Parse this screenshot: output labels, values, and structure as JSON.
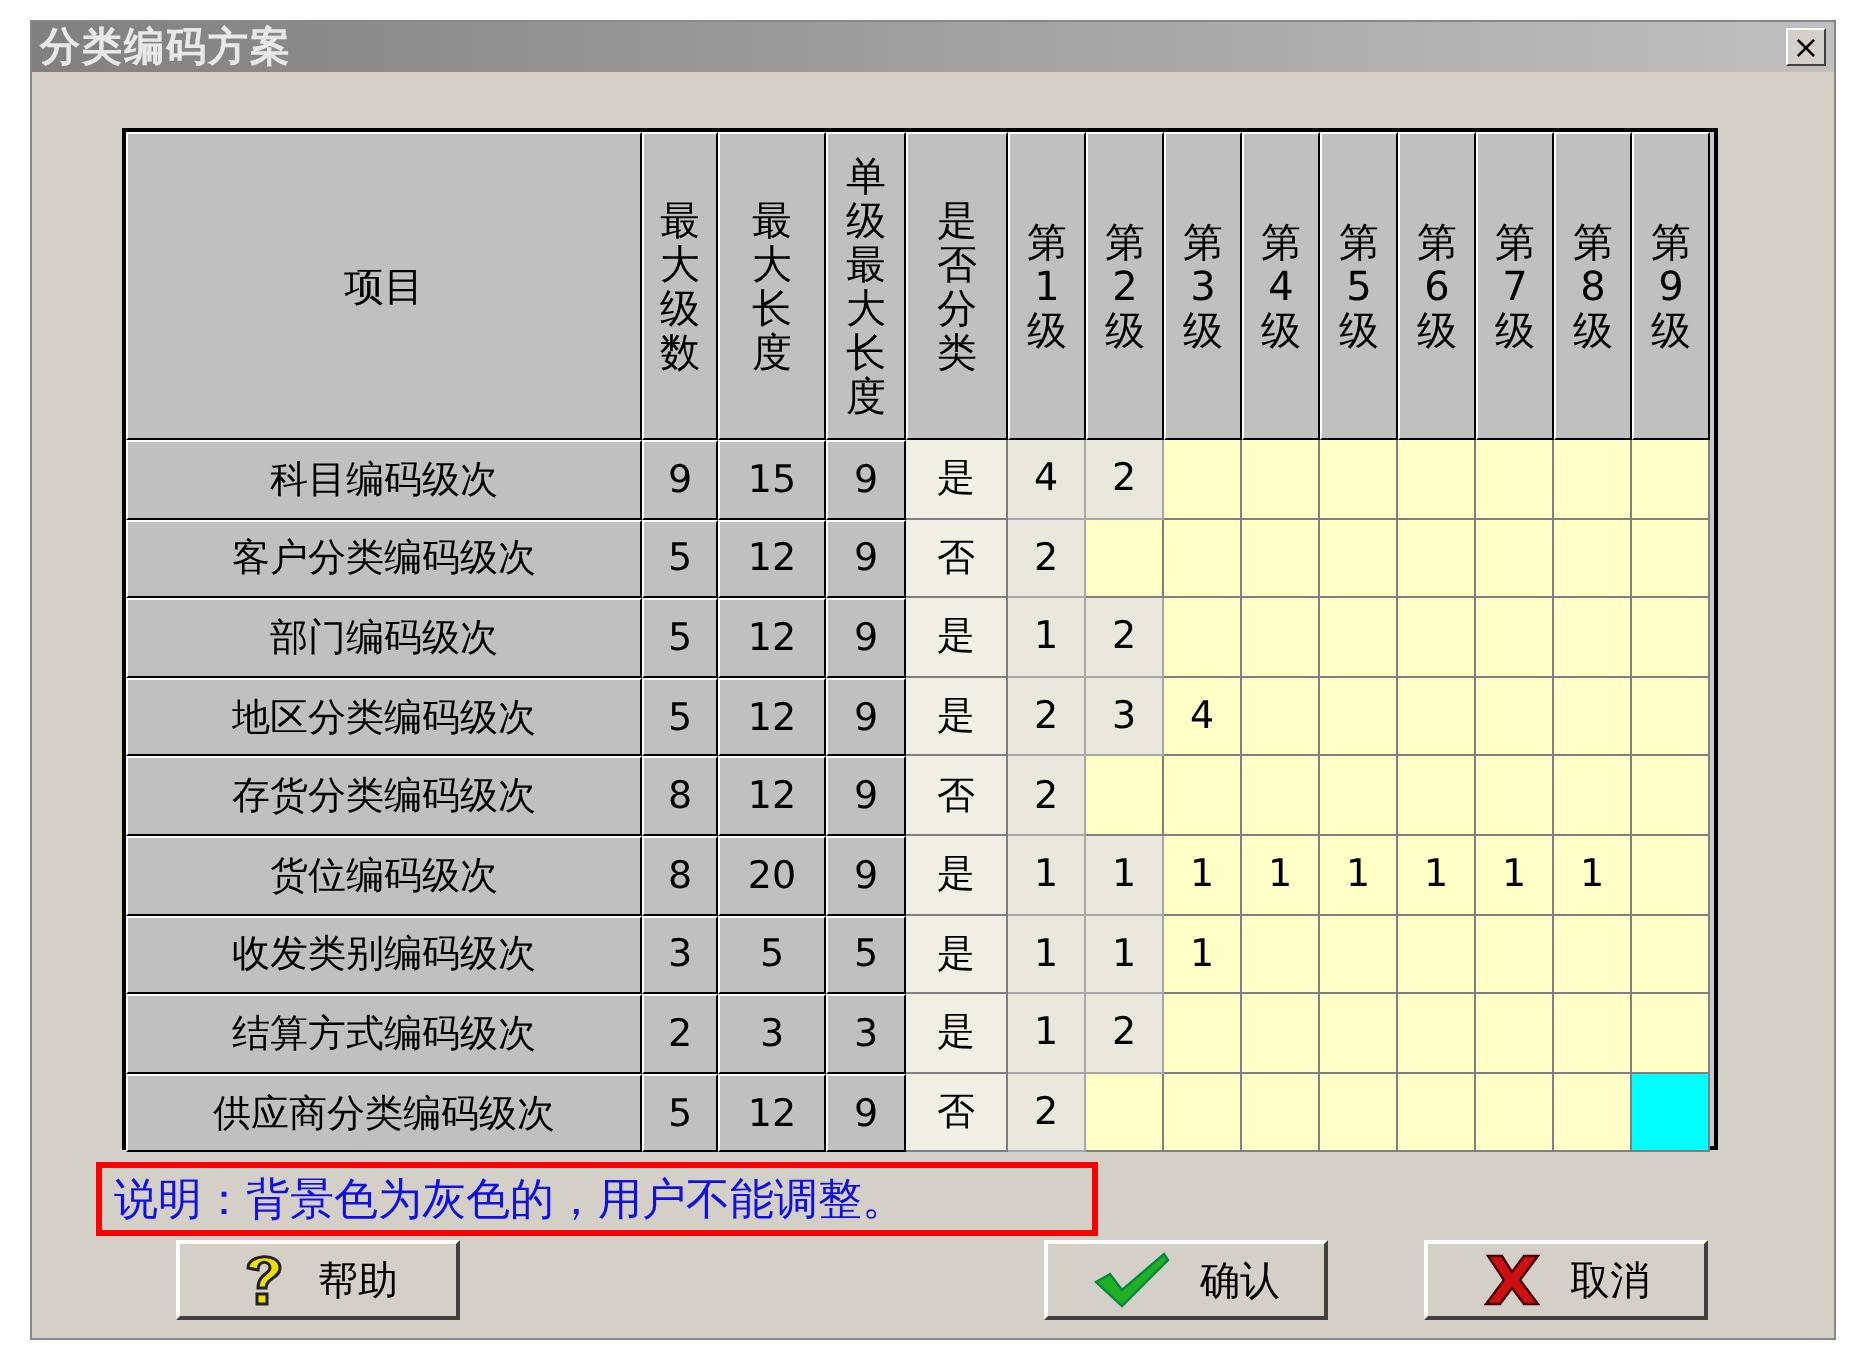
{
  "window": {
    "title": "分类编码方案",
    "close": "×"
  },
  "table": {
    "columns": [
      "项目",
      "最大级数",
      "最大长度",
      "单级最大长度",
      "是否分类",
      "第1级",
      "第2级",
      "第3级",
      "第4级",
      "第5级",
      "第6级",
      "第7级",
      "第8级",
      "第9级"
    ],
    "rows": [
      {
        "item": "科目编码级次",
        "max_levels": "9",
        "max_length": "15",
        "max_single": "9",
        "classified": "是",
        "levels": [
          {
            "value": "4",
            "locked": true,
            "selected": false
          },
          {
            "value": "2",
            "locked": true,
            "selected": false
          },
          {
            "locked": false,
            "selected": false
          },
          {
            "locked": false,
            "selected": false
          },
          {
            "locked": false,
            "selected": false
          },
          {
            "locked": false,
            "selected": false
          },
          {
            "locked": false,
            "selected": false
          },
          {
            "locked": false,
            "selected": false
          },
          {
            "locked": false,
            "selected": false
          }
        ]
      },
      {
        "item": "客户分类编码级次",
        "max_levels": "5",
        "max_length": "12",
        "max_single": "9",
        "classified": "否",
        "levels": [
          {
            "value": "2",
            "locked": true,
            "selected": false
          },
          {
            "locked": false,
            "selected": false
          },
          {
            "locked": false,
            "selected": false
          },
          {
            "locked": false,
            "selected": false
          },
          {
            "locked": false,
            "selected": false
          },
          {
            "locked": false,
            "selected": false
          },
          {
            "locked": false,
            "selected": false
          },
          {
            "locked": false,
            "selected": false
          },
          {
            "locked": false,
            "selected": false
          }
        ]
      },
      {
        "item": "部门编码级次",
        "max_levels": "5",
        "max_length": "12",
        "max_single": "9",
        "classified": "是",
        "levels": [
          {
            "value": "1",
            "locked": true,
            "selected": false
          },
          {
            "value": "2",
            "locked": true,
            "selected": false
          },
          {
            "locked": false,
            "selected": false
          },
          {
            "locked": false,
            "selected": false
          },
          {
            "locked": false,
            "selected": false
          },
          {
            "locked": false,
            "selected": false
          },
          {
            "locked": false,
            "selected": false
          },
          {
            "locked": false,
            "selected": false
          },
          {
            "locked": false,
            "selected": false
          }
        ]
      },
      {
        "item": "地区分类编码级次",
        "max_levels": "5",
        "max_length": "12",
        "max_single": "9",
        "classified": "是",
        "levels": [
          {
            "value": "2",
            "locked": true,
            "selected": false
          },
          {
            "value": "3",
            "locked": true,
            "selected": false
          },
          {
            "value": "4",
            "locked": false,
            "selected": false
          },
          {
            "locked": false,
            "selected": false
          },
          {
            "locked": false,
            "selected": false
          },
          {
            "locked": false,
            "selected": false
          },
          {
            "locked": false,
            "selected": false
          },
          {
            "locked": false,
            "selected": false
          },
          {
            "locked": false,
            "selected": false
          }
        ]
      },
      {
        "item": "存货分类编码级次",
        "max_levels": "8",
        "max_length": "12",
        "max_single": "9",
        "classified": "否",
        "levels": [
          {
            "value": "2",
            "locked": true,
            "selected": false
          },
          {
            "locked": false,
            "selected": false
          },
          {
            "locked": false,
            "selected": false
          },
          {
            "locked": false,
            "selected": false
          },
          {
            "locked": false,
            "selected": false
          },
          {
            "locked": false,
            "selected": false
          },
          {
            "locked": false,
            "selected": false
          },
          {
            "locked": false,
            "selected": false
          },
          {
            "locked": false,
            "selected": false
          }
        ]
      },
      {
        "item": "货位编码级次",
        "max_levels": "8",
        "max_length": "20",
        "max_single": "9",
        "classified": "是",
        "levels": [
          {
            "value": "1",
            "locked": true,
            "selected": false
          },
          {
            "value": "1",
            "locked": true,
            "selected": false
          },
          {
            "value": "1",
            "locked": false,
            "selected": false
          },
          {
            "value": "1",
            "locked": false,
            "selected": false
          },
          {
            "value": "1",
            "locked": false,
            "selected": false
          },
          {
            "value": "1",
            "locked": false,
            "selected": false
          },
          {
            "value": "1",
            "locked": false,
            "selected": false
          },
          {
            "value": "1",
            "locked": false,
            "selected": false
          },
          {
            "locked": false,
            "selected": false
          }
        ]
      },
      {
        "item": "收发类别编码级次",
        "max_levels": "3",
        "max_length": "5",
        "max_single": "5",
        "classified": "是",
        "levels": [
          {
            "value": "1",
            "locked": true,
            "selected": false
          },
          {
            "value": "1",
            "locked": true,
            "selected": false
          },
          {
            "value": "1",
            "locked": false,
            "selected": false
          },
          {
            "locked": false,
            "selected": false
          },
          {
            "locked": false,
            "selected": false
          },
          {
            "locked": false,
            "selected": false
          },
          {
            "locked": false,
            "selected": false
          },
          {
            "locked": false,
            "selected": false
          },
          {
            "locked": false,
            "selected": false
          }
        ]
      },
      {
        "item": "结算方式编码级次",
        "max_levels": "2",
        "max_length": "3",
        "max_single": "3",
        "classified": "是",
        "levels": [
          {
            "value": "1",
            "locked": true,
            "selected": false
          },
          {
            "value": "2",
            "locked": true,
            "selected": false
          },
          {
            "locked": false,
            "selected": false
          },
          {
            "locked": false,
            "selected": false
          },
          {
            "locked": false,
            "selected": false
          },
          {
            "locked": false,
            "selected": false
          },
          {
            "locked": false,
            "selected": false
          },
          {
            "locked": false,
            "selected": false
          },
          {
            "locked": false,
            "selected": false
          }
        ]
      },
      {
        "item": "供应商分类编码级次",
        "max_levels": "5",
        "max_length": "12",
        "max_single": "9",
        "classified": "否",
        "levels": [
          {
            "value": "2",
            "locked": true,
            "selected": false
          },
          {
            "locked": false,
            "selected": false
          },
          {
            "locked": false,
            "selected": false
          },
          {
            "locked": false,
            "selected": false
          },
          {
            "locked": false,
            "selected": false
          },
          {
            "locked": false,
            "selected": false
          },
          {
            "locked": false,
            "selected": false
          },
          {
            "locked": false,
            "selected": false
          },
          {
            "locked": false,
            "selected": true
          }
        ]
      }
    ]
  },
  "note": "说明：背景色为灰色的，用户不能调整。",
  "buttons": [
    {
      "kind": "help",
      "label": "帮助"
    },
    {
      "kind": "confirm",
      "label": "确认"
    },
    {
      "kind": "cancel",
      "label": "取消"
    }
  ]
}
